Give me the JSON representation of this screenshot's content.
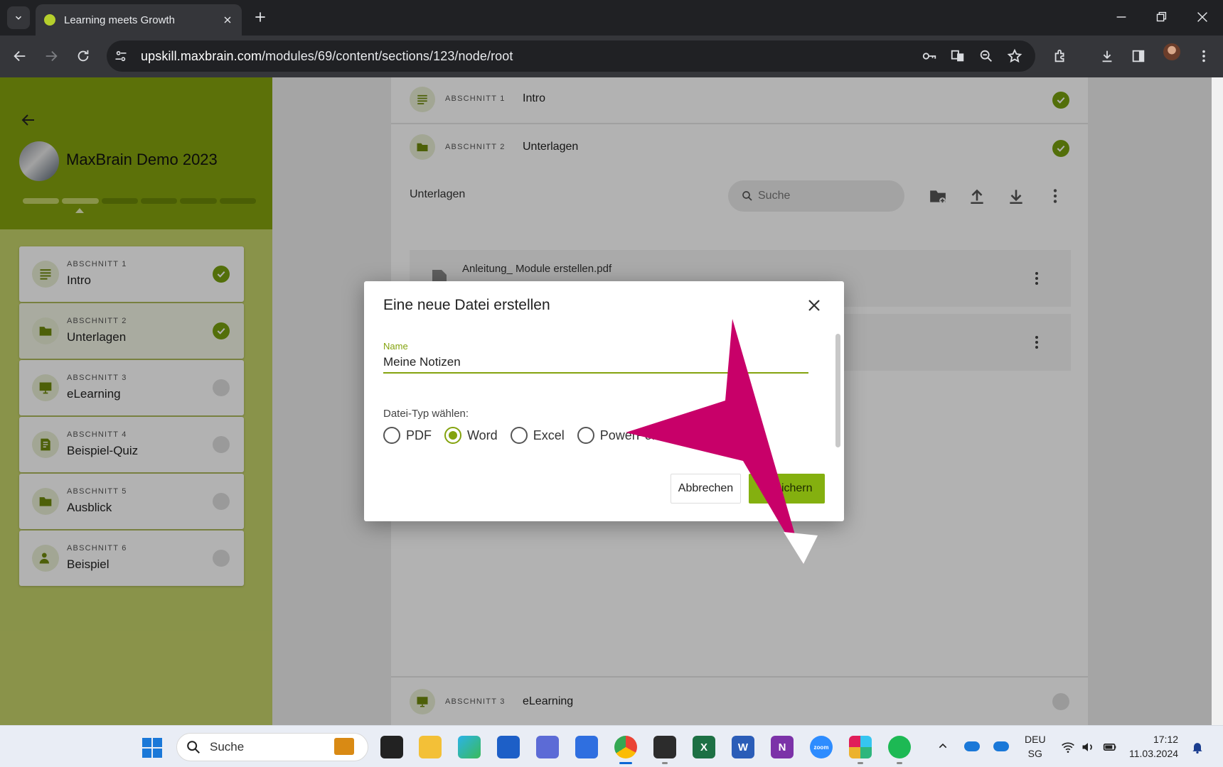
{
  "browser": {
    "tab_title": "Learning meets Growth",
    "url_domain": "upskill.maxbrain.com",
    "url_path": "/modules/69/content/sections/123/node/root"
  },
  "sidebar": {
    "title": "MaxBrain Demo 2023",
    "progress": {
      "segments": 6,
      "completed": 2
    },
    "sections": [
      {
        "kicker": "ABSCHNITT 1",
        "label": "Intro",
        "icon": "text-lines-icon",
        "done": true
      },
      {
        "kicker": "ABSCHNITT 2",
        "label": "Unterlagen",
        "icon": "folder-icon",
        "done": true
      },
      {
        "kicker": "ABSCHNITT 3",
        "label": "eLearning",
        "icon": "monitor-icon",
        "done": false
      },
      {
        "kicker": "ABSCHNITT 4",
        "label": "Beispiel-Quiz",
        "icon": "quiz-icon",
        "done": false
      },
      {
        "kicker": "ABSCHNITT 5",
        "label": "Ausblick",
        "icon": "folder-icon",
        "done": false
      },
      {
        "kicker": "ABSCHNITT 6",
        "label": "Beispiel",
        "icon": "person-icon",
        "done": false
      }
    ]
  },
  "main": {
    "rows": [
      {
        "kicker": "ABSCHNITT 1",
        "label": "Intro"
      },
      {
        "kicker": "ABSCHNITT 2",
        "label": "Unterlagen"
      },
      {
        "kicker": "ABSCHNITT 3",
        "label": "eLearning"
      }
    ],
    "folder_title": "Unterlagen",
    "search_placeholder": "Suche",
    "files": [
      "Anleitung_ Module erstellen.pdf"
    ]
  },
  "dialog": {
    "title": "Eine neue Datei erstellen",
    "name_label": "Name",
    "name_value": "Meine Notizen",
    "type_label": "Datei-Typ wählen:",
    "types": [
      "PDF",
      "Word",
      "Excel",
      "PowerPoint"
    ],
    "selected_type": "Word",
    "cancel_label": "Abbrechen",
    "save_label": "Speichern"
  },
  "taskbar": {
    "search_label": "Suche",
    "lang_top": "DEU",
    "lang_bottom": "SG",
    "time": "17:12",
    "date": "11.03.2024"
  },
  "colors": {
    "brand_green": "#84a30e",
    "sidebar_light": "#c5d36a",
    "annotation_magenta": "#c80069"
  }
}
